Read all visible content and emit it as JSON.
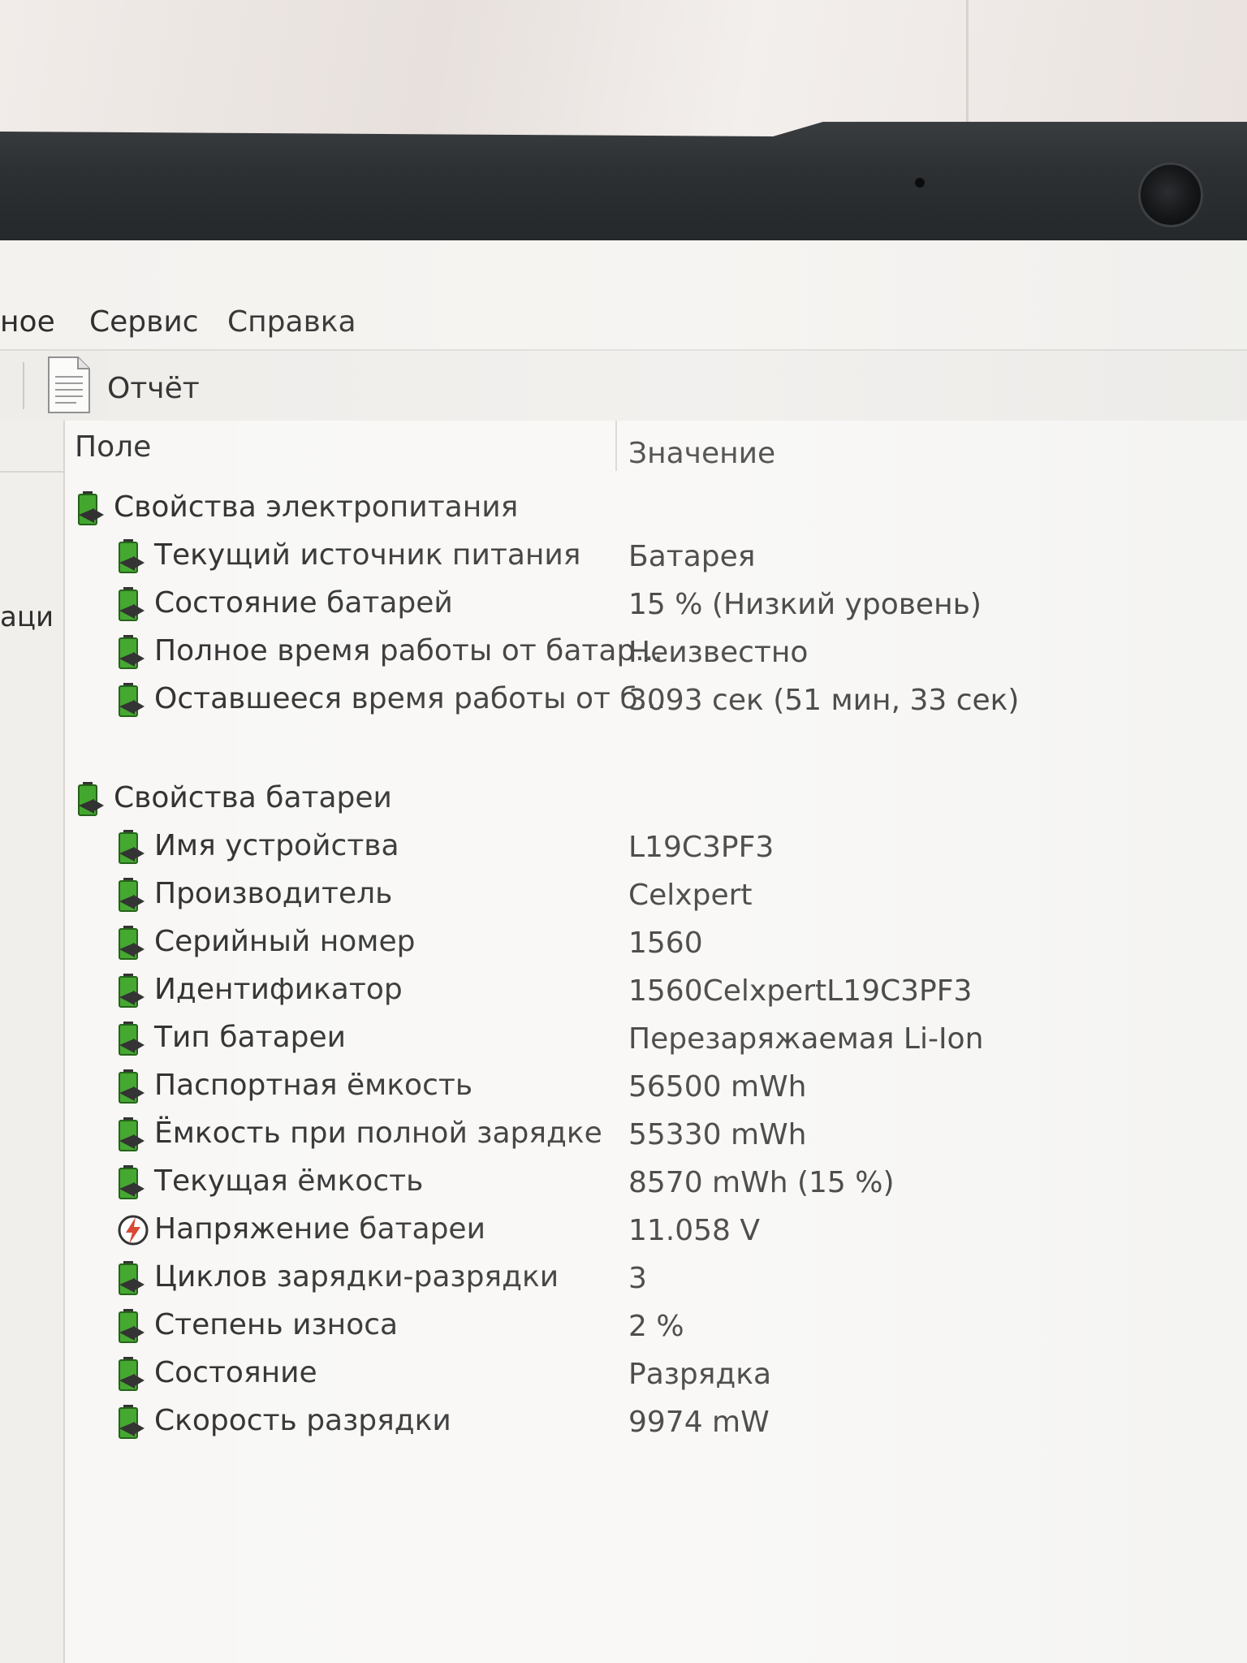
{
  "menu": {
    "items": [
      "ное",
      "Сервис",
      "Справка"
    ]
  },
  "toolbar": {
    "report_label": "Отчёт"
  },
  "left_pane": {
    "visible_text": "аци"
  },
  "table": {
    "columns": {
      "field": "Поле",
      "value": "Значение"
    },
    "groups": [
      {
        "title": "Свойства электропитания",
        "rows": [
          {
            "field": "Текущий источник питания",
            "value": "Батарея"
          },
          {
            "field": "Состояние батарей",
            "value": "15 % (Низкий уровень)"
          },
          {
            "field": "Полное время работы от батар...",
            "value": "Неизвестно"
          },
          {
            "field": "Оставшееся время работы от б...",
            "value": "3093 сек (51 мин, 33 сек)"
          }
        ]
      },
      {
        "title": "Свойства батареи",
        "rows": [
          {
            "field": "Имя устройства",
            "value": "L19C3PF3"
          },
          {
            "field": "Производитель",
            "value": "Celxpert"
          },
          {
            "field": "Серийный номер",
            "value": "1560"
          },
          {
            "field": "Идентификатор",
            "value": "1560CelxpertL19C3PF3"
          },
          {
            "field": "Тип батареи",
            "value": "Перезаряжаемая Li-Ion"
          },
          {
            "field": "Паспортная ёмкость",
            "value": "56500 mWh"
          },
          {
            "field": "Ёмкость при полной зарядке",
            "value": "55330 mWh"
          },
          {
            "field": "Текущая ёмкость",
            "value": "8570 mWh  (15 %)"
          },
          {
            "field": "Напряжение батареи",
            "value": "11.058 V",
            "icon": "voltage"
          },
          {
            "field": "Циклов зарядки-разрядки",
            "value": "3"
          },
          {
            "field": "Степень износа",
            "value": "2 %"
          },
          {
            "field": "Состояние",
            "value": "Разрядка"
          },
          {
            "field": "Скорость разрядки",
            "value": "9974 mW"
          }
        ]
      }
    ]
  },
  "colors": {
    "battery_icon": "#3fa52a",
    "battery_icon_dark": "#2d2d2d",
    "voltage_icon": "#d8432d"
  },
  "icons": {
    "battery": "battery-icon",
    "voltage": "voltage-icon",
    "report": "report-icon"
  }
}
